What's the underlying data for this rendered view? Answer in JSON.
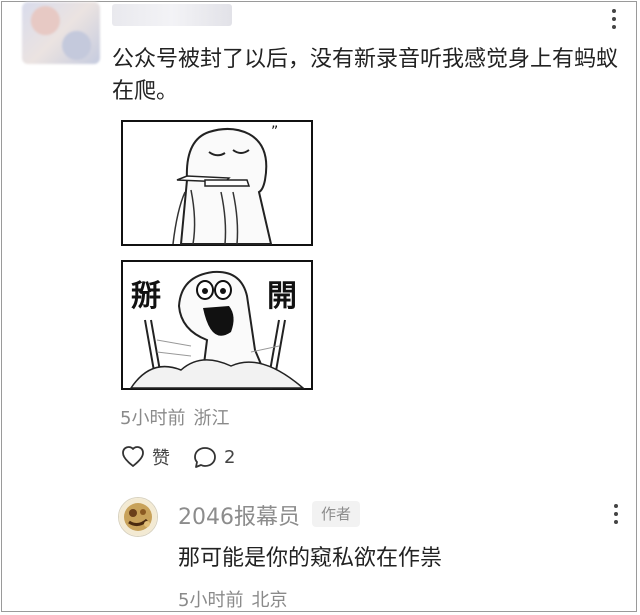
{
  "comment": {
    "text": "公众号被封了以后，没有新录音听我感觉身上有蚂蚁在爬。",
    "time": "5小时前",
    "location": "浙江",
    "like_label": "赞",
    "reply_count": "2",
    "icons": {
      "more": "more-vertical-icon",
      "like": "thumb-up-icon",
      "reply": "comment-bubble-icon"
    }
  },
  "comic": {
    "top_text": "”",
    "left_text": "掰",
    "right_text": "開"
  },
  "reply": {
    "name": "2046报幕员",
    "badge": "作者",
    "text": "那可能是你的窥私欲在作祟",
    "time": "5小时前",
    "location": "北京"
  }
}
